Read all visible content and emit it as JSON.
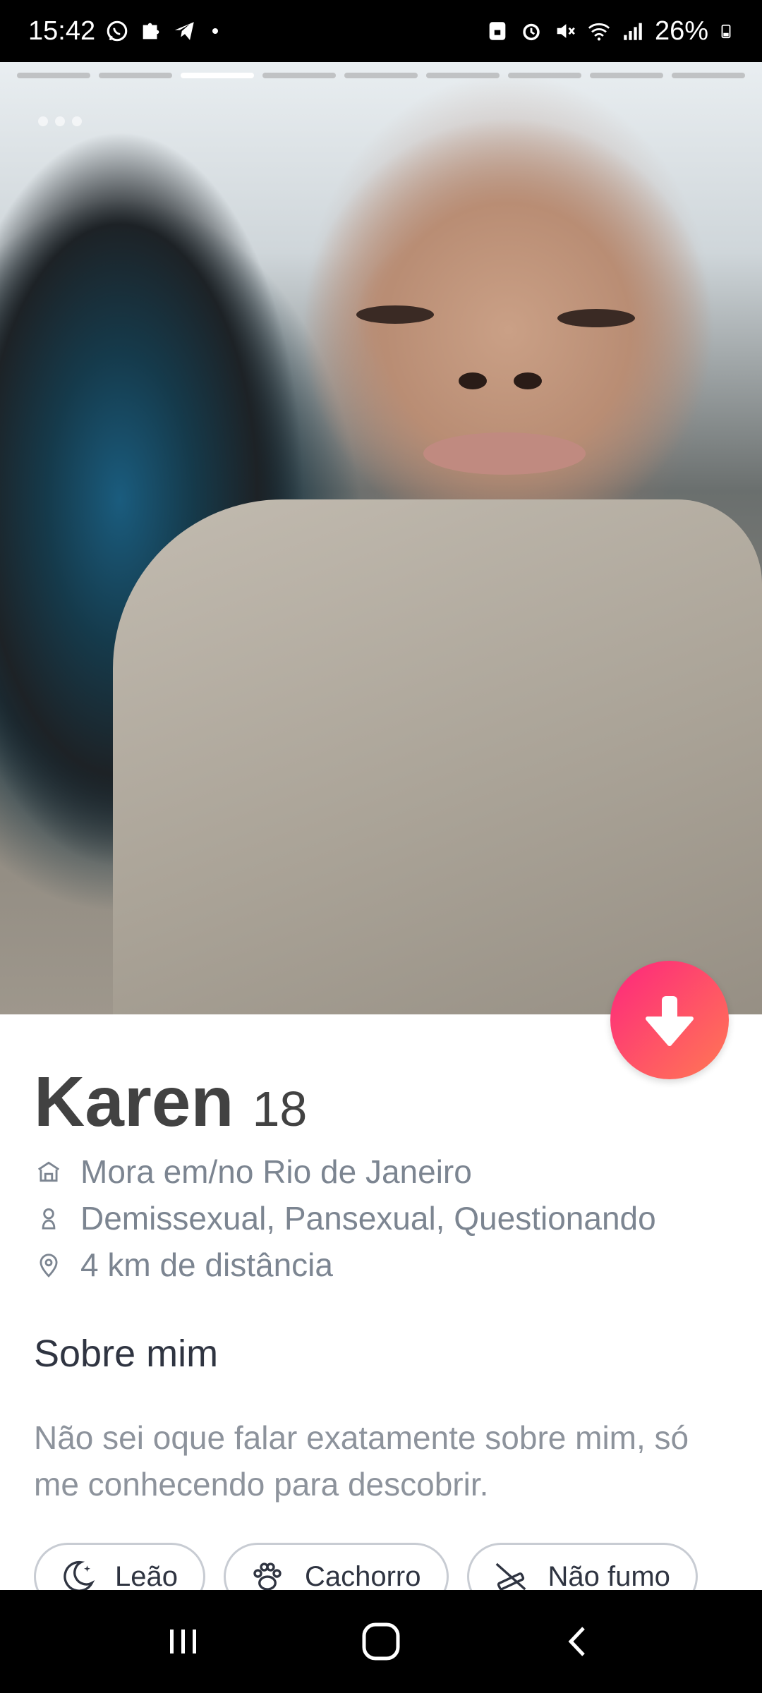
{
  "status_bar": {
    "time": "15:42",
    "battery": "26%",
    "left_icons": [
      "whatsapp-icon",
      "puzzle-icon",
      "telegram-icon",
      "dot-icon"
    ],
    "right_icons": [
      "lock-icon",
      "alarm-icon",
      "mute-icon",
      "wifi-icon",
      "signal-icon",
      "battery-icon"
    ]
  },
  "photo": {
    "progress_segments": 9,
    "active_segment": 3
  },
  "profile": {
    "name": "Karen",
    "age": "18",
    "details": [
      {
        "icon": "home-icon",
        "text": "Mora em/no Rio de Janeiro"
      },
      {
        "icon": "person-icon",
        "text": "Demissexual, Pansexual, Questionando"
      },
      {
        "icon": "location-pin-icon",
        "text": "4 km de distância"
      }
    ]
  },
  "about": {
    "title": "Sobre mim",
    "bio": "Não sei oque falar exatamente sobre mim, só me conhecendo para descobrir."
  },
  "chips": [
    {
      "icon": "moon-icon",
      "label": "Leão"
    },
    {
      "icon": "paw-icon",
      "label": "Cachorro"
    },
    {
      "icon": "smoking-icon",
      "label": "Não fumo"
    }
  ],
  "colors": {
    "accent_start": "#fd267d",
    "accent_end": "#ff7854",
    "text_dark": "#424242",
    "text_muted": "#7c8591"
  }
}
